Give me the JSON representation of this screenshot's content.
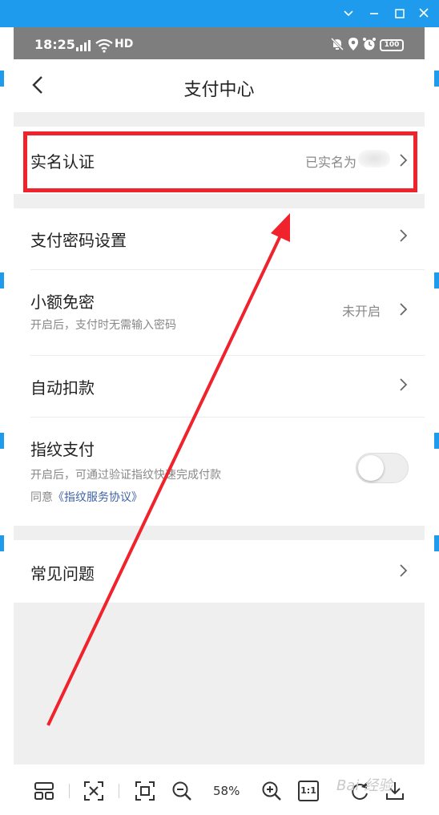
{
  "phone": {
    "status_bar": {
      "time": "18:25",
      "network": "HD",
      "battery": "100"
    },
    "header": {
      "title": "支付中心"
    },
    "items": [
      {
        "label": "实名认证",
        "value": "已实名为"
      },
      {
        "label": "支付密码设置"
      },
      {
        "label": "小额免密",
        "subtitle": "开启后，支付时无需输入密码",
        "value": "未开启"
      },
      {
        "label": "自动扣款"
      },
      {
        "label": "指纹支付",
        "subtitle": "开启后，可通过验证指纹快速完成付款",
        "agree_prefix": "同意",
        "agree_link": "《指纹服务协议》",
        "toggle_on": false
      },
      {
        "label": "常见问题"
      }
    ]
  },
  "viewer": {
    "zoom": "58%",
    "actual_size": "1:1",
    "watermark": "Bai 经验"
  },
  "colors": {
    "highlight": "#f0222b",
    "titlebar": "#1e9bec",
    "status_bar": "#7e7e7e",
    "link": "#3f63a6"
  }
}
